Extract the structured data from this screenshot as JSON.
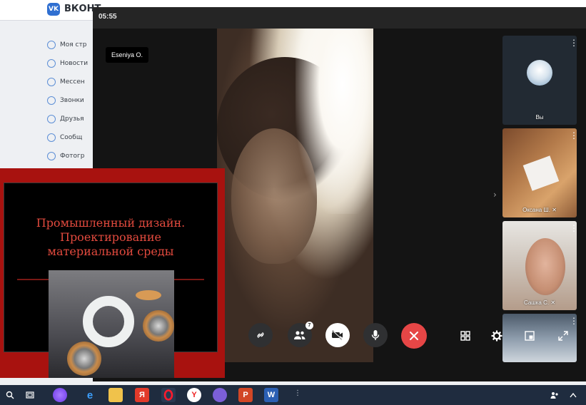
{
  "vk": {
    "brand": "ВКОНТ",
    "logo": "VK",
    "nav": [
      "Моя стр",
      "Новости",
      "Мессен",
      "Звонки",
      "Друзья",
      "Сообщ",
      "Фотогр"
    ]
  },
  "call": {
    "timer": "05:55",
    "speaker_name": "Eseniya O.",
    "participants_badge": "7",
    "thumbnails": [
      {
        "label": "Вы"
      },
      {
        "label": "Оксана Ш."
      },
      {
        "label": "Сашка С."
      },
      {
        "label": ""
      }
    ]
  },
  "presentation": {
    "title_line1": "Промышленный дизайн.",
    "title_line2": "Проектирование",
    "title_line3": "материальной среды"
  },
  "taskbar": {
    "apps": [
      "search-icon",
      "task-view-icon",
      "alice-icon",
      "edge-icon",
      "explorer-icon",
      "yandex-icon",
      "opera-icon",
      "yandex-browser-icon",
      "viber-icon",
      "powerpoint-icon",
      "word-icon"
    ]
  },
  "colors": {
    "end_call": "#e64646",
    "slide_title": "#e24a3e",
    "slide_border": "#a8120f",
    "taskbar": "#1f2c3f"
  }
}
